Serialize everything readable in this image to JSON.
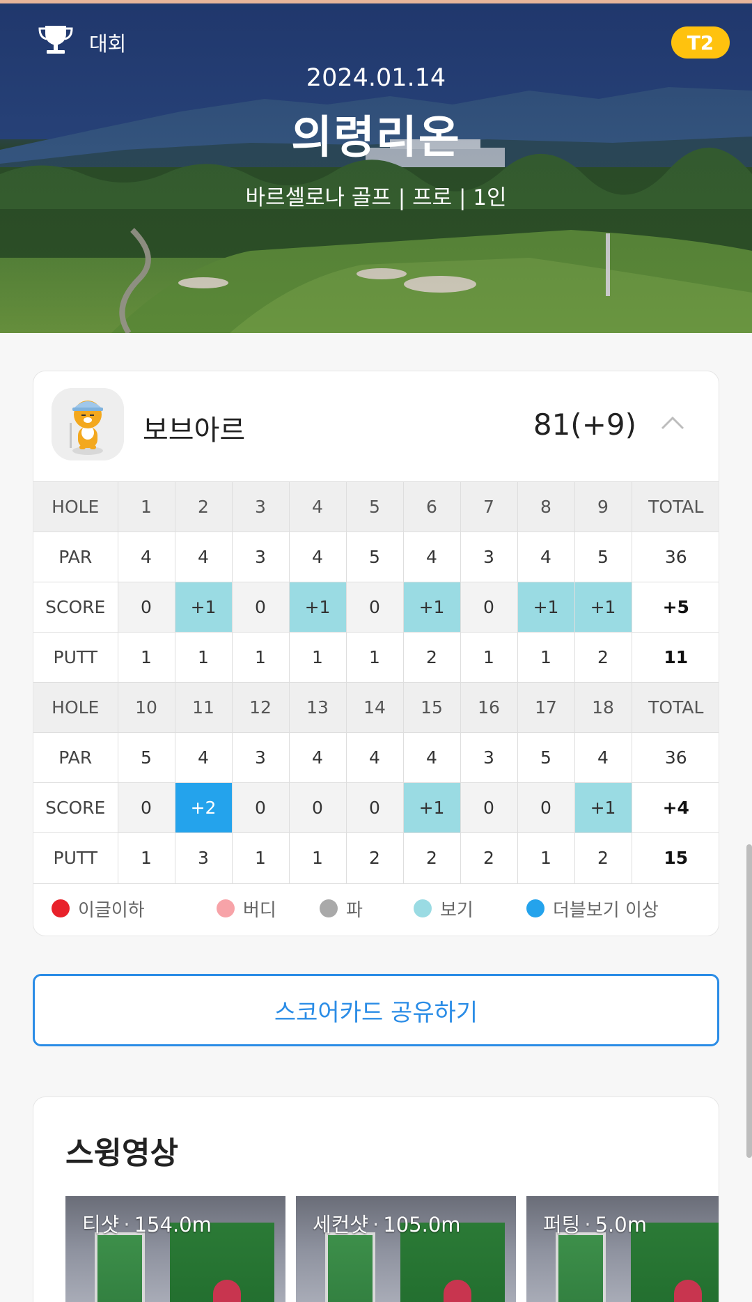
{
  "hero": {
    "category": "대회",
    "tier_badge": "T2",
    "date": "2024.01.14",
    "course_name": "의령리온",
    "subtitle": "바르셀로나 골프  | 프로 | 1인"
  },
  "player": {
    "name": "보브아르",
    "score": "81(+9)"
  },
  "scorecard": {
    "front": {
      "hole": [
        "HOLE",
        "1",
        "2",
        "3",
        "4",
        "5",
        "6",
        "7",
        "8",
        "9",
        "TOTAL"
      ],
      "par": [
        "PAR",
        "4",
        "4",
        "3",
        "4",
        "5",
        "4",
        "3",
        "4",
        "5",
        "36"
      ],
      "score": [
        "SCORE",
        "0",
        "+1",
        "0",
        "+1",
        "0",
        "+1",
        "0",
        "+1",
        "+1",
        "+5"
      ],
      "putt": [
        "PUTT",
        "1",
        "1",
        "1",
        "1",
        "1",
        "2",
        "1",
        "1",
        "2",
        "11"
      ]
    },
    "back": {
      "hole": [
        "HOLE",
        "10",
        "11",
        "12",
        "13",
        "14",
        "15",
        "16",
        "17",
        "18",
        "TOTAL"
      ],
      "par": [
        "PAR",
        "5",
        "4",
        "3",
        "4",
        "4",
        "4",
        "3",
        "5",
        "4",
        "36"
      ],
      "score": [
        "SCORE",
        "0",
        "+2",
        "0",
        "0",
        "0",
        "+1",
        "0",
        "0",
        "+1",
        "+4"
      ],
      "putt": [
        "PUTT",
        "1",
        "3",
        "1",
        "1",
        "2",
        "2",
        "2",
        "1",
        "2",
        "15"
      ]
    }
  },
  "legend": [
    {
      "label": "이글이하",
      "color": "#e8212a"
    },
    {
      "label": "버디",
      "color": "#f7a3a8"
    },
    {
      "label": "파",
      "color": "#a9a9a9"
    },
    {
      "label": "보기",
      "color": "#9adbe3"
    },
    {
      "label": "더블보기 이상",
      "color": "#24a3ec"
    }
  ],
  "share_button": "스코어카드 공유하기",
  "swing": {
    "title": "스윙영상",
    "videos": [
      {
        "shot": "티샷",
        "distance": "154.0m"
      },
      {
        "shot": "세컨샷",
        "distance": "105.0m"
      },
      {
        "shot": "퍼팅",
        "distance": "5.0m"
      }
    ]
  },
  "colors": {
    "bogey": "#9adbe3",
    "double_bogey": "#24a3ec",
    "accent": "#2a8ce6",
    "badge": "#ffc20e"
  }
}
